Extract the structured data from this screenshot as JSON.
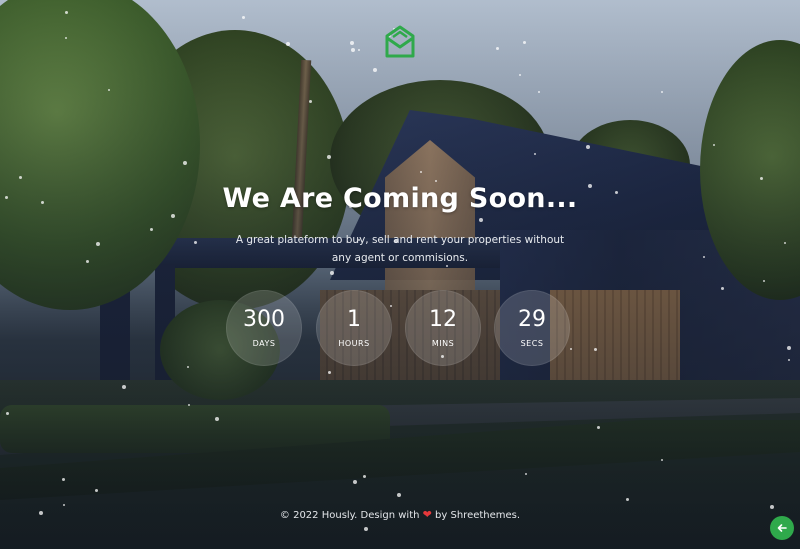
{
  "brand": {
    "logo_icon": "house-envelope-icon",
    "logo_color": "#2fa94b"
  },
  "hero": {
    "heading": "We Are Coming Soon...",
    "subtitle": "A great plateform to buy, sell and rent your properties without any agent or commisions."
  },
  "countdown": [
    {
      "value": "300",
      "label": "DAYS"
    },
    {
      "value": "1",
      "label": "HOURS"
    },
    {
      "value": "12",
      "label": "MINS"
    },
    {
      "value": "29",
      "label": "SECS"
    }
  ],
  "footer": {
    "prefix": "© 2022 Hously. Design with",
    "heart_icon": "heart-icon",
    "heart_color": "#e5383b",
    "suffix": "by Shreethemes."
  },
  "back_button": {
    "icon": "arrow-left-icon",
    "color": "#2fa94b"
  }
}
